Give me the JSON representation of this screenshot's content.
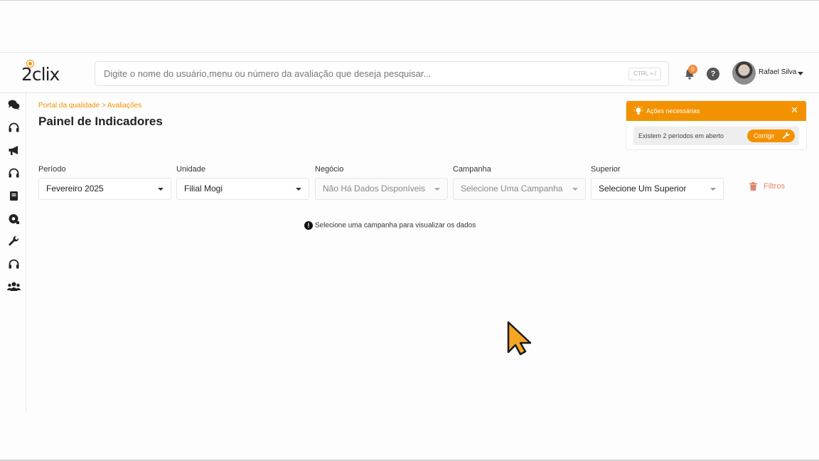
{
  "header": {
    "logo_text": "2clix",
    "search": {
      "placeholder": "Digite o nome do usuário,menu ou número da avaliação que deseja pesquisar...",
      "value": "",
      "shortcut": "CTRL + /"
    },
    "notifications_count": "0",
    "help_label": "?",
    "user": {
      "name": "Rafael Silva"
    }
  },
  "sidebar": {
    "items": [
      {
        "icon": "comments-icon"
      },
      {
        "icon": "headset-icon"
      },
      {
        "icon": "megaphone-icon"
      },
      {
        "icon": "headset-icon"
      },
      {
        "icon": "book-icon"
      },
      {
        "icon": "gear-badge-icon"
      },
      {
        "icon": "wrench-icon"
      },
      {
        "icon": "headset-icon"
      },
      {
        "icon": "users-icon"
      }
    ]
  },
  "content": {
    "breadcrumb": "Portal da qualidade > Avaliações",
    "title": "Painel de Indicadores",
    "filters": [
      {
        "label": "Período",
        "value": "Fevereiro 2025",
        "disabled": false
      },
      {
        "label": "Unidade",
        "value": "Filial Mogi",
        "disabled": false
      },
      {
        "label": "Negócio",
        "value": "Não Há Dados Disponíveis",
        "disabled": true
      },
      {
        "label": "Campanha",
        "value": "Selecione Uma Campanha",
        "disabled": true
      },
      {
        "label": "Superior",
        "value": "Selecione Um Superior",
        "disabled": false
      }
    ],
    "filters_button": "Filtros",
    "info_message": "Selecione uma campanha para visualizar os dados"
  },
  "actions_panel": {
    "title": "Ações necessárias",
    "close": "✕",
    "message": "Existem 2 períodos em aberto",
    "fix_button": "Corrigir"
  },
  "colors": {
    "accent": "#f39200",
    "danger": "#e5836d"
  }
}
